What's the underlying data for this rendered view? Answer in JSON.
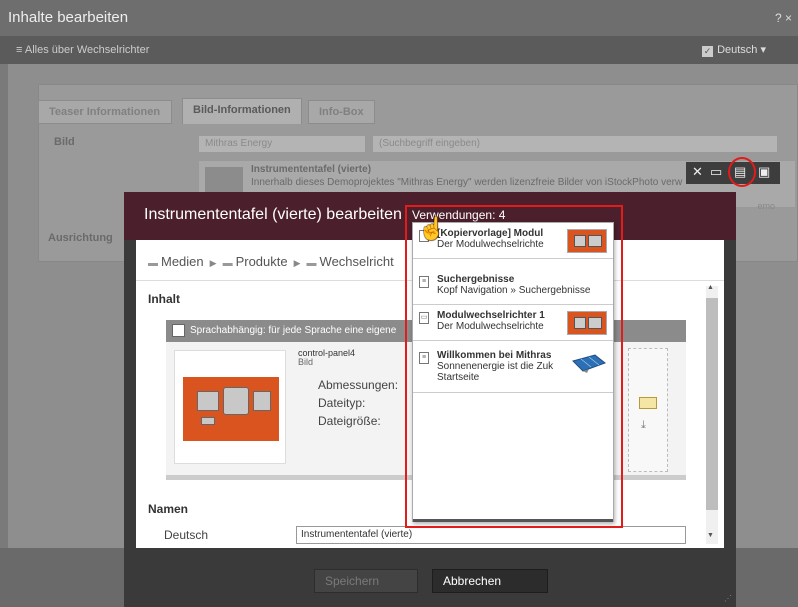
{
  "outer": {
    "title": "Inhalte bearbeiten",
    "controls": "? ×",
    "subtitle": "≡ Alles über Wechselrichter",
    "language": "Deutsch ▾",
    "language_check": "✓",
    "tabs": [
      "Teaser Informationen",
      "Bild-Informationen",
      "Info-Box"
    ],
    "bild_label": "Bild",
    "ausrichtung_label": "Ausrichtung",
    "select_value": "Mithras Energy",
    "search_placeholder": "(Suchbegriff eingeben)",
    "item_title": "Instrumententafel (vierte)",
    "item_desc": "Innerhalb dieses Demoprojektes \"Mithras Energy\" werden lizenzfreie Bilder von iStockPhoto verw",
    "item_trail": "emo"
  },
  "modal": {
    "title": "Instrumententafel (vierte) bearbeiten",
    "usage_label": "Verwendungen: 4",
    "breadcrumb": [
      "Medien",
      "Produkte",
      "Wechselricht"
    ],
    "inhalt_label": "Inhalt",
    "lang_dependent_text": "Sprachabhängig: für jede Sprache eine eigene",
    "image_name": "control-panel4",
    "image_type": "Bild",
    "meta_labels": [
      "Abmessungen:",
      "Dateityp:",
      "Dateigröße:"
    ],
    "namen_label": "Namen",
    "deutsch_label": "Deutsch",
    "name_value": "Instrumententafel (vierte)",
    "save_label": "Speichern",
    "cancel_label": "Abbrechen"
  },
  "usages": [
    {
      "line1": "[Kopiervorlage] Modul",
      "line2": "Der Modulwechselrichte",
      "line3": "",
      "thumb": "image"
    },
    {
      "line1": "Suchergebnisse",
      "line2": "Kopf Navigation » Suchergebnisse",
      "line3": "",
      "thumb": "none"
    },
    {
      "line1": "Modulwechselrichter 1",
      "line2": "Der Modulwechselrichte",
      "line3": "",
      "thumb": "image"
    },
    {
      "line1": "Willkommen bei Mithras",
      "line2": "Sonnenenergie ist die Zuk",
      "line3": "Startseite",
      "thumb": "solar"
    }
  ],
  "colors": {
    "modal_header": "#4b1f2c",
    "highlight": "#e21b1b"
  }
}
